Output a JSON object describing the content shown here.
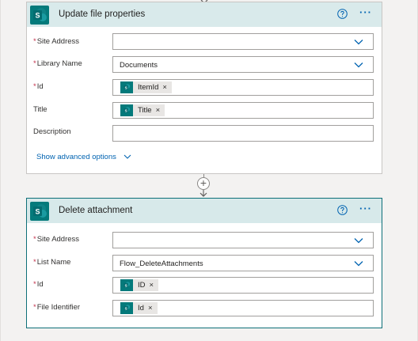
{
  "card1": {
    "title": "Update file properties",
    "help_icon": "help-circle-icon",
    "more_icon": "more-horizontal-icon",
    "more_label": "···",
    "fields": [
      {
        "label": "Site Address",
        "required": true,
        "type": "dropdown",
        "value": ""
      },
      {
        "label": "Library Name",
        "required": true,
        "type": "dropdown",
        "value": "Documents"
      },
      {
        "label": "Id",
        "required": true,
        "type": "token",
        "token": "ItemId"
      },
      {
        "label": "Title",
        "required": false,
        "type": "token",
        "token": "Title"
      },
      {
        "label": "Description",
        "required": false,
        "type": "text",
        "value": ""
      }
    ],
    "advanced_link": "Show advanced options"
  },
  "connector": {
    "add_label": "+",
    "icon": "add-step-icon"
  },
  "card2": {
    "title": "Delete attachment",
    "help_icon": "help-circle-icon",
    "more_icon": "more-horizontal-icon",
    "more_label": "···",
    "fields": [
      {
        "label": "Site Address",
        "required": true,
        "type": "dropdown",
        "value": ""
      },
      {
        "label": "List Name",
        "required": true,
        "type": "dropdown",
        "value": "Flow_DeleteAttachments"
      },
      {
        "label": "Id",
        "required": true,
        "type": "token",
        "token": "ID"
      },
      {
        "label": "File Identifier",
        "required": true,
        "type": "token",
        "token": "Id"
      }
    ]
  },
  "token_remove_label": "×",
  "required_mark": "*",
  "colors": {
    "accent": "#0063b1",
    "sharepoint_teal": "#047a7b",
    "header_bg": "#d7e9ea",
    "required": "#c4314b",
    "selected_border": "#0d6f78"
  }
}
